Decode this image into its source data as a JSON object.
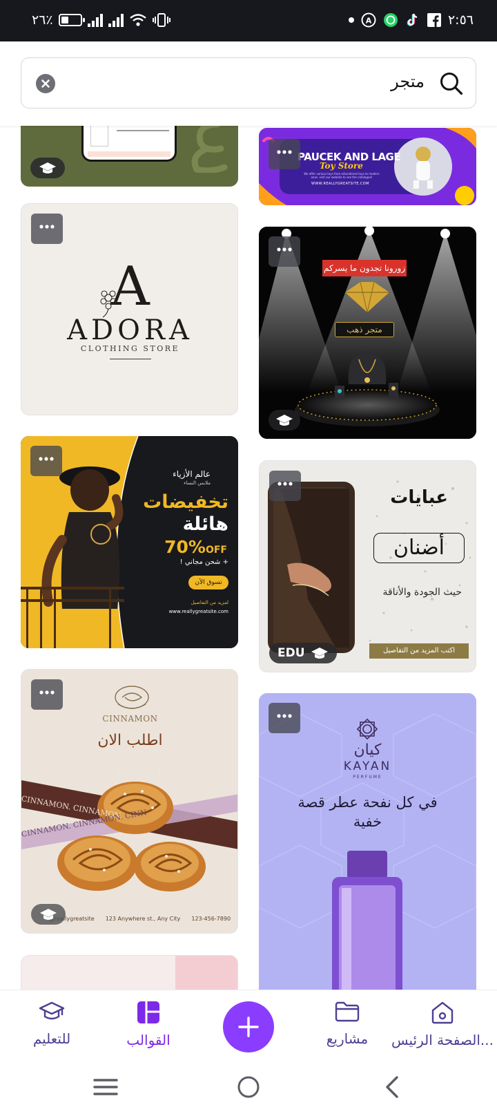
{
  "status_bar": {
    "time": "٢:٥٦",
    "battery_percent": "٢٦٪"
  },
  "search": {
    "query": "متجر"
  },
  "cards": {
    "c1": {
      "name": "olive-education-template"
    },
    "c2": {
      "title": "PAUCEK AND LAGE",
      "subtitle": "Toy Store",
      "body": "We offer various toys from educational toys to modern ones. visit our website to see the catalogue!",
      "url": "WWW.REALLYGREATSITE.COM"
    },
    "c3": {
      "letter": "A",
      "brand": "ADORA",
      "tagline": "CLOTHING STORE"
    },
    "c4": {
      "banner": "زورونا تجدون ما يسركم",
      "store": "متجر ذهب"
    },
    "c5": {
      "brand": "عالم الأزياء",
      "brand_sub": "ملابس النساء",
      "headline1": "تخفيضات",
      "headline2": "هائلة",
      "discount": "70%",
      "discount_off": "OFF",
      "shipping": "+ شحن مجاني !",
      "cta": "تسوق الآن",
      "more": "لمزيد من التفاصيل",
      "url": "www.reallygreatsite.com"
    },
    "c6": {
      "title": "عبايات",
      "brand": "أضنان",
      "tagline": "حيث الجودة والأناقة",
      "cta": "اكتب المزيد من التفاصيل",
      "badge": "EDU"
    },
    "c7": {
      "brand": "CINNAMON",
      "headline": "اطلب الان",
      "ribbon1": "CINNAMON. CINNAMON.",
      "ribbon2": "CINNAMON. CINNAMON. CINN",
      "footer1": "@reallygreatsite",
      "footer2": "123 Anywhere st., Any City",
      "footer3": "123-456-7890"
    },
    "c8": {
      "brand_ar": "كيان",
      "brand": "KAYAN",
      "brand_sub": "PERFUME",
      "headline": "في كل نفحة عطر قصة خفية"
    }
  },
  "bottom_nav": {
    "home": "الصفحة الرئيس...",
    "projects": "مشاريع",
    "templates": "القوالب",
    "learn": "للتعليم"
  },
  "colors": {
    "accent": "#8b3dff",
    "nav_text": "#4a3f93"
  }
}
